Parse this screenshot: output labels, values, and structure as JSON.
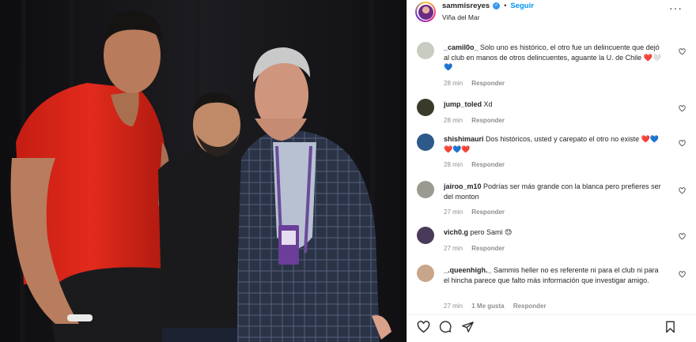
{
  "post": {
    "username": "sammisreyes",
    "follow_label": "Seguir",
    "location": "Viña del Mar",
    "dot": "•",
    "more": "···"
  },
  "comments": [
    {
      "user": "_camil0o_",
      "text": "Solo uno es histórico, el otro fue un delincuente que dejó al club en manos de otros delincuentes, aguante la U. de Chile ❤️🤍💙",
      "time": "28 min",
      "likes": "",
      "reply": "Responder",
      "avatar_color": "#c8cdc2"
    },
    {
      "user": "jump_toled",
      "text": "Xd",
      "time": "28 min",
      "likes": "",
      "reply": "Responder",
      "avatar_color": "#3a3a2a"
    },
    {
      "user": "shishimauri",
      "text": "Dos históricos, usted y carepato el otro no existe ❤️💙❤️💙❤️",
      "time": "28 min",
      "likes": "",
      "reply": "Responder",
      "avatar_color": "#2d5a8a"
    },
    {
      "user": "jairoo_m10",
      "text": "Podrías ser más grande con la blanca pero prefieres ser del monton",
      "time": "27 min",
      "likes": "",
      "reply": "Responder",
      "avatar_color": "#9a9a90"
    },
    {
      "user": "vich0.g",
      "text": "pero Sami 😓",
      "time": "27 min",
      "likes": "",
      "reply": "Responder",
      "avatar_color": "#4a3a5a"
    },
    {
      "user": "_.queenhigh._",
      "text": "Sammis heller no es referente ni para el club ni para el hincha parece que falto más información que investigar amigo.",
      "time": "27 min",
      "likes": "1 Me gusta",
      "reply": "Responder",
      "avatar_color": "#c9a58a"
    }
  ],
  "icons": [
    "heart-icon",
    "comment-icon",
    "share-icon",
    "bookmark-icon",
    "verified-icon",
    "more-icon"
  ],
  "colors": {
    "accent": "#0095f6",
    "verified": "#3897f0",
    "muted": "#8e8e8e",
    "shirt": "#d92518"
  }
}
